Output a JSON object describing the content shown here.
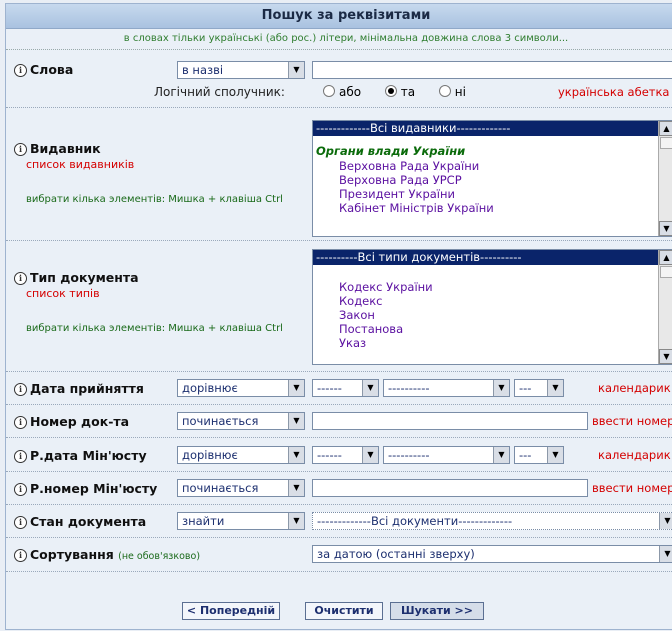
{
  "title": "Пошук за реквізитами",
  "hint": "в словах тільки українські (або рос.) літери, мінімальна довжина слова 3 символи...",
  "words": {
    "label": "Слова",
    "scope": "в назві",
    "logic_label": "Логічний сполучник:",
    "options": [
      "або",
      "та",
      "ні"
    ],
    "selected": "та",
    "side_link": "українська абетка"
  },
  "publisher": {
    "label": "Видавник",
    "list_link": "список видавників",
    "multi_hint": "вибрати кілька элементів: Мишка + клавіша Ctrl",
    "selected_item": "-------------Всі видавники-------------",
    "group": "Органи влади України",
    "items": [
      "Верховна Рада України",
      "Верховна Рада УРСР",
      "Президент України",
      "Кабінет Міністрів України"
    ]
  },
  "doctype": {
    "label": "Тип документа",
    "list_link": "список типів",
    "multi_hint": "вибрати кілька элементів: Мишка + клавіша Ctrl",
    "selected_item": "----------Всі типи документів----------",
    "items": [
      "Кодекс України",
      "Кодекс",
      "Закон",
      "Постанова",
      "Указ"
    ]
  },
  "date_adopted": {
    "label": "Дата прийняття",
    "op": "дорівнює",
    "day": "------",
    "month": "----------",
    "year": "---",
    "side_link": "календарик"
  },
  "doc_number": {
    "label": "Номер док-та",
    "op": "починається",
    "side_link": "ввести номер"
  },
  "reg_date": {
    "label": "Р.дата Мін'юсту",
    "op": "дорівнює",
    "day": "------",
    "month": "----------",
    "year": "---",
    "side_link": "календарик"
  },
  "reg_number": {
    "label": "Р.номер Мін'юсту",
    "op": "починається",
    "side_link": "ввести номер"
  },
  "status": {
    "label": "Стан документа",
    "op": "знайти",
    "value": "-------------Всі документи-------------"
  },
  "sort": {
    "label": "Сортування",
    "note": "(не обов'язково)",
    "value": "за датою (останні зверху)"
  },
  "buttons": {
    "prev": "< Попередній",
    "clear": "Очистити",
    "search": "Шукати >>"
  },
  "icons": {
    "info": "info-icon",
    "dropdown": "chevron-down-icon"
  },
  "colors": {
    "link_red": "#d40000",
    "hint_green": "#1a6a1a",
    "list_selection": "#0a246a"
  }
}
